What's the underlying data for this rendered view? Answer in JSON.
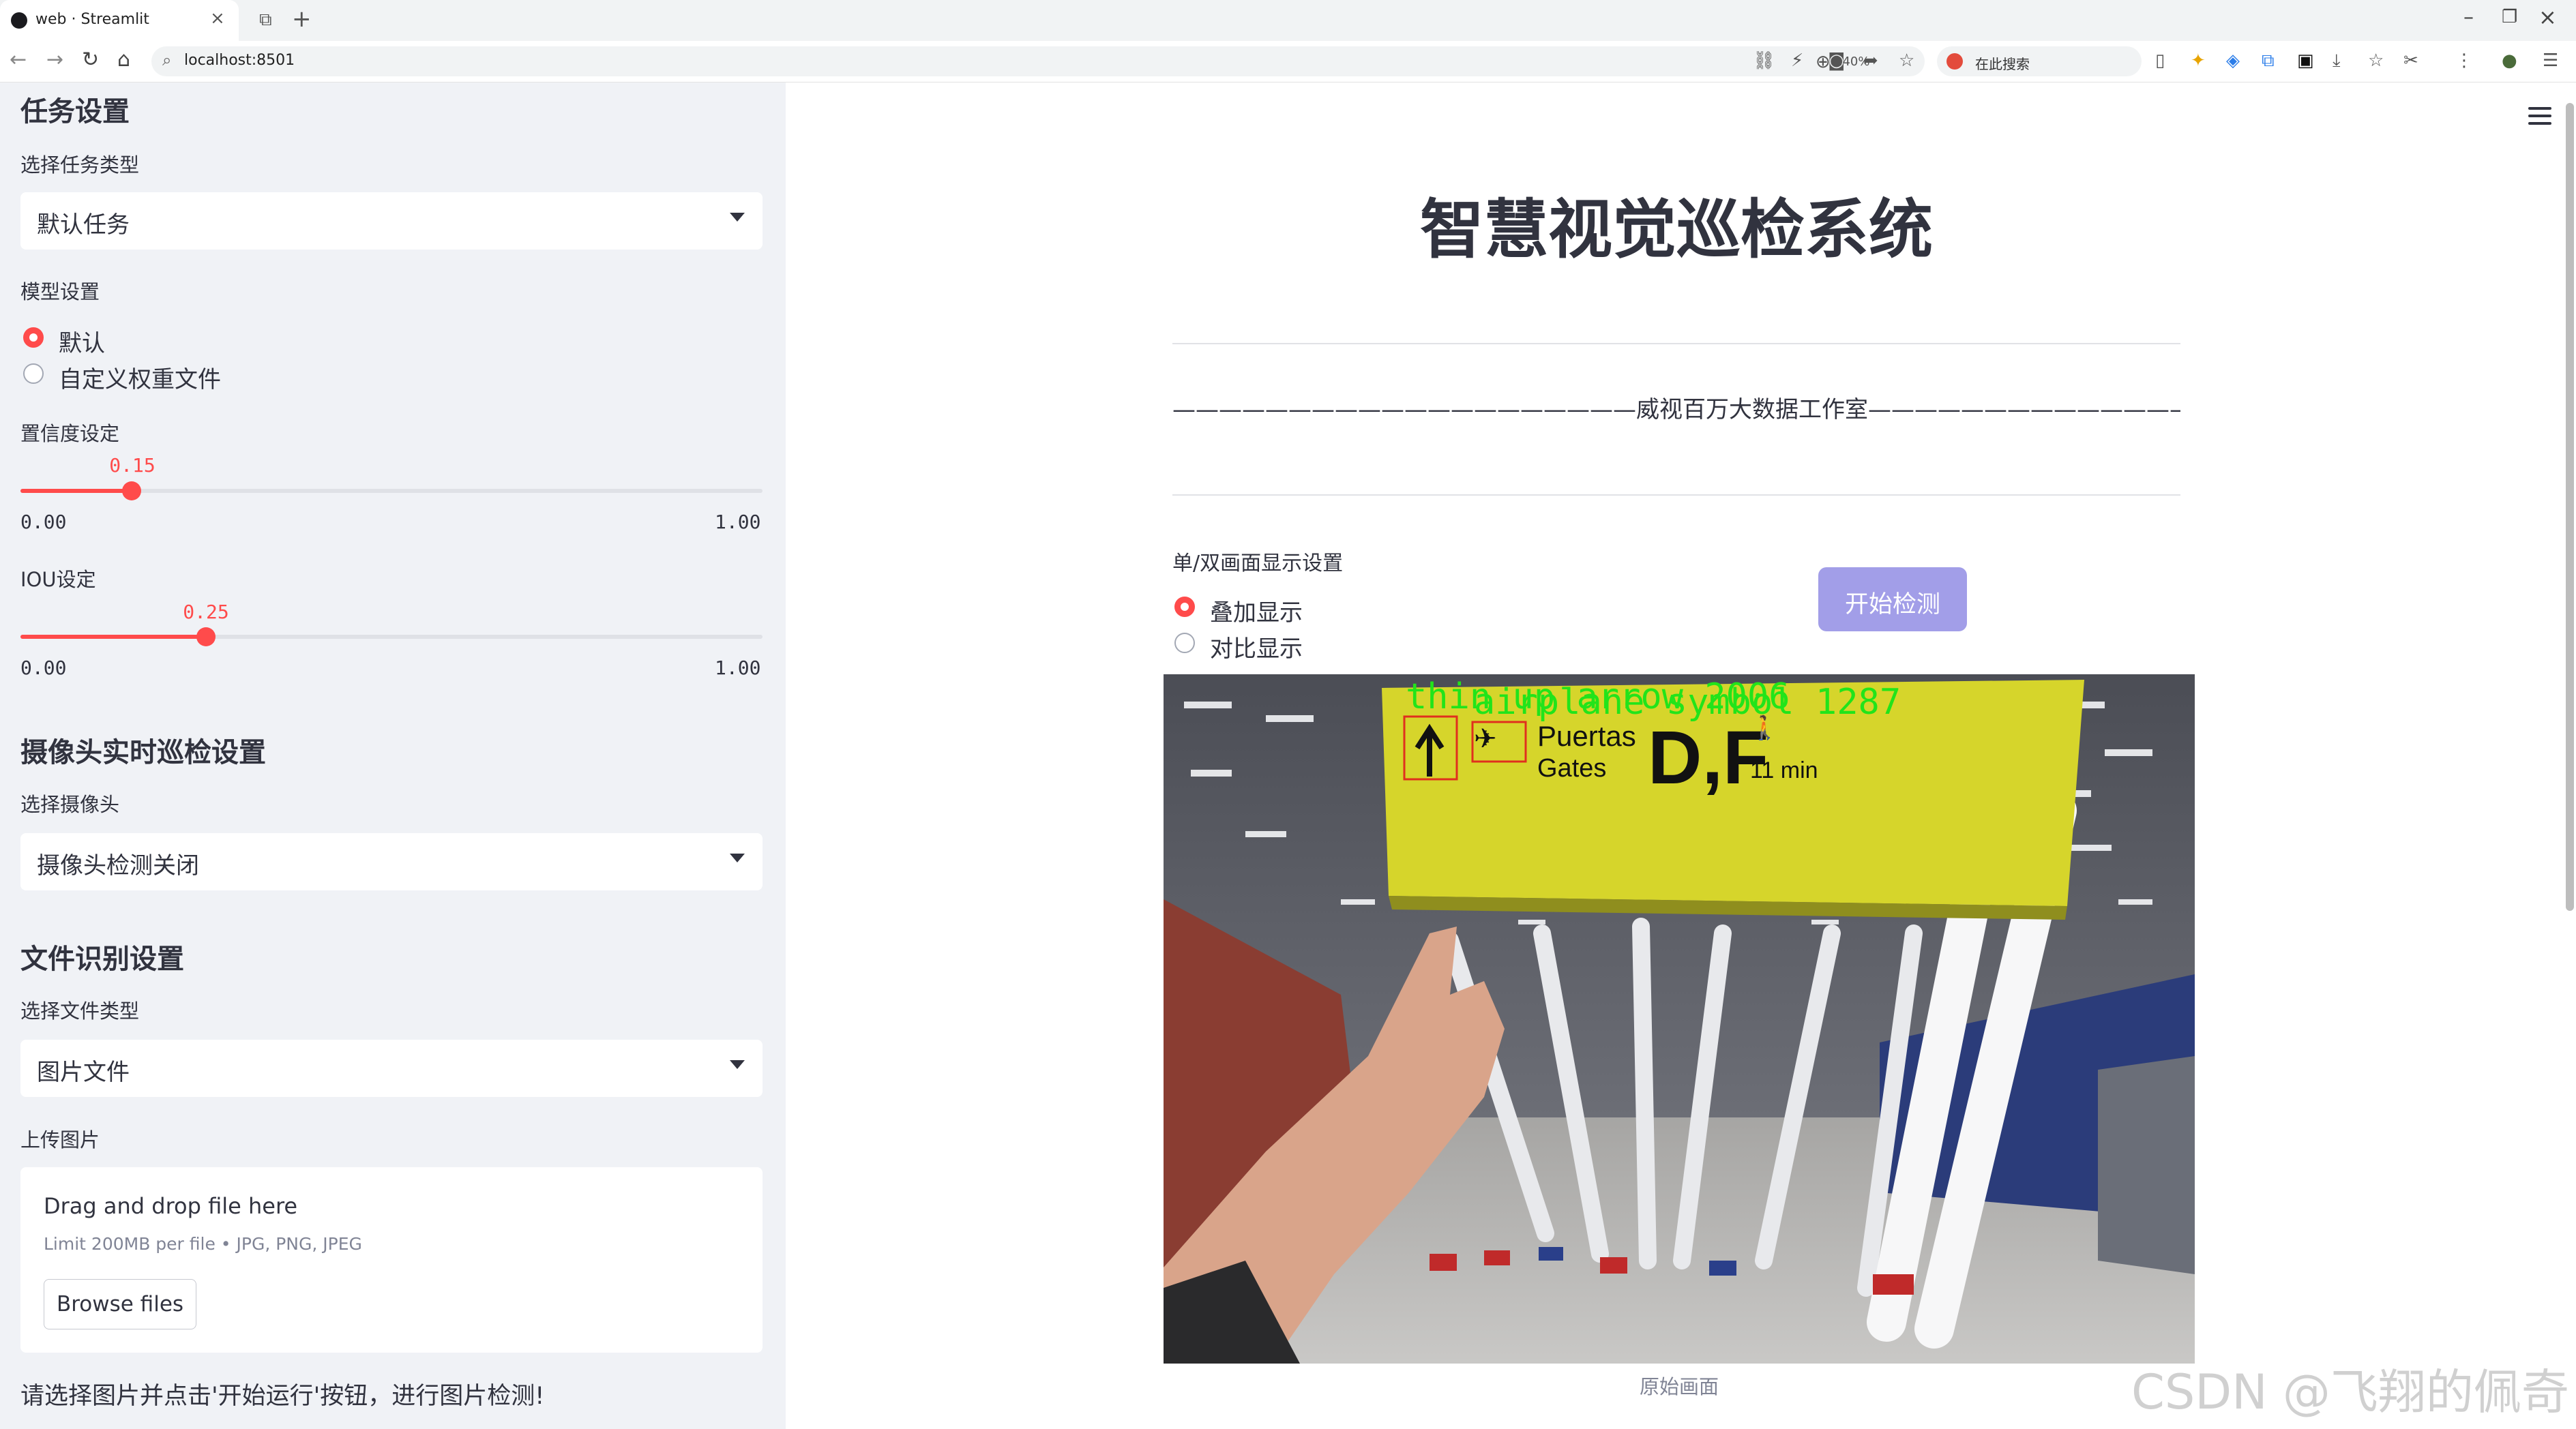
{
  "browser": {
    "tab_title": "web · Streamlit",
    "url": "localhost:8501",
    "zoom": "140%",
    "search_label": "在此搜索"
  },
  "sidebar": {
    "task_section_title": "任务设置",
    "task_type_label": "选择任务类型",
    "task_type_value": "默认任务",
    "model_label": "模型设置",
    "model_options": [
      "默认",
      "自定义权重文件"
    ],
    "model_selected": 0,
    "confidence": {
      "label": "置信度设定",
      "value_text": "0.15",
      "value": 0.15,
      "min": "0.00",
      "max": "1.00"
    },
    "iou": {
      "label": "IOU设定",
      "value_text": "0.25",
      "value": 0.25,
      "min": "0.00",
      "max": "1.00"
    },
    "camera_section_title": "摄像头实时巡检设置",
    "camera_label": "选择摄像头",
    "camera_value": "摄像头检测关闭",
    "file_section_title": "文件识别设置",
    "file_type_label": "选择文件类型",
    "file_type_value": "图片文件",
    "upload_label": "上传图片",
    "upload_title": "Drag and drop file here",
    "upload_limit": "Limit 200MB per file • JPG, PNG, JPEG",
    "browse_label": "Browse files",
    "hint": "请选择图片并点击'开始运行'按钮，进行图片检测!"
  },
  "main": {
    "title": "智慧视觉巡检系统",
    "studio": "————————————————————威视百万大数据工作室————————————————————",
    "display_label": "单/双画面显示设置",
    "display_options": [
      "叠加显示",
      "对比显示"
    ],
    "display_selected": 0,
    "start_button": "开始检测",
    "image": {
      "sign_text_1": "Puertas",
      "sign_text_2": "Gates",
      "sign_letters": "D,F",
      "sign_time": "11 min",
      "det_label_1": "thin up arrow 2006",
      "det_label_2": "airplane symbol 1287"
    },
    "caption": "原始画面"
  },
  "watermark": "CSDN @飞翔的佩奇",
  "colors": {
    "accent": "#ff4b4b",
    "button": "#a29ee8",
    "sidebar_bg": "#f0f2f6",
    "sign": "#d6d52b"
  }
}
